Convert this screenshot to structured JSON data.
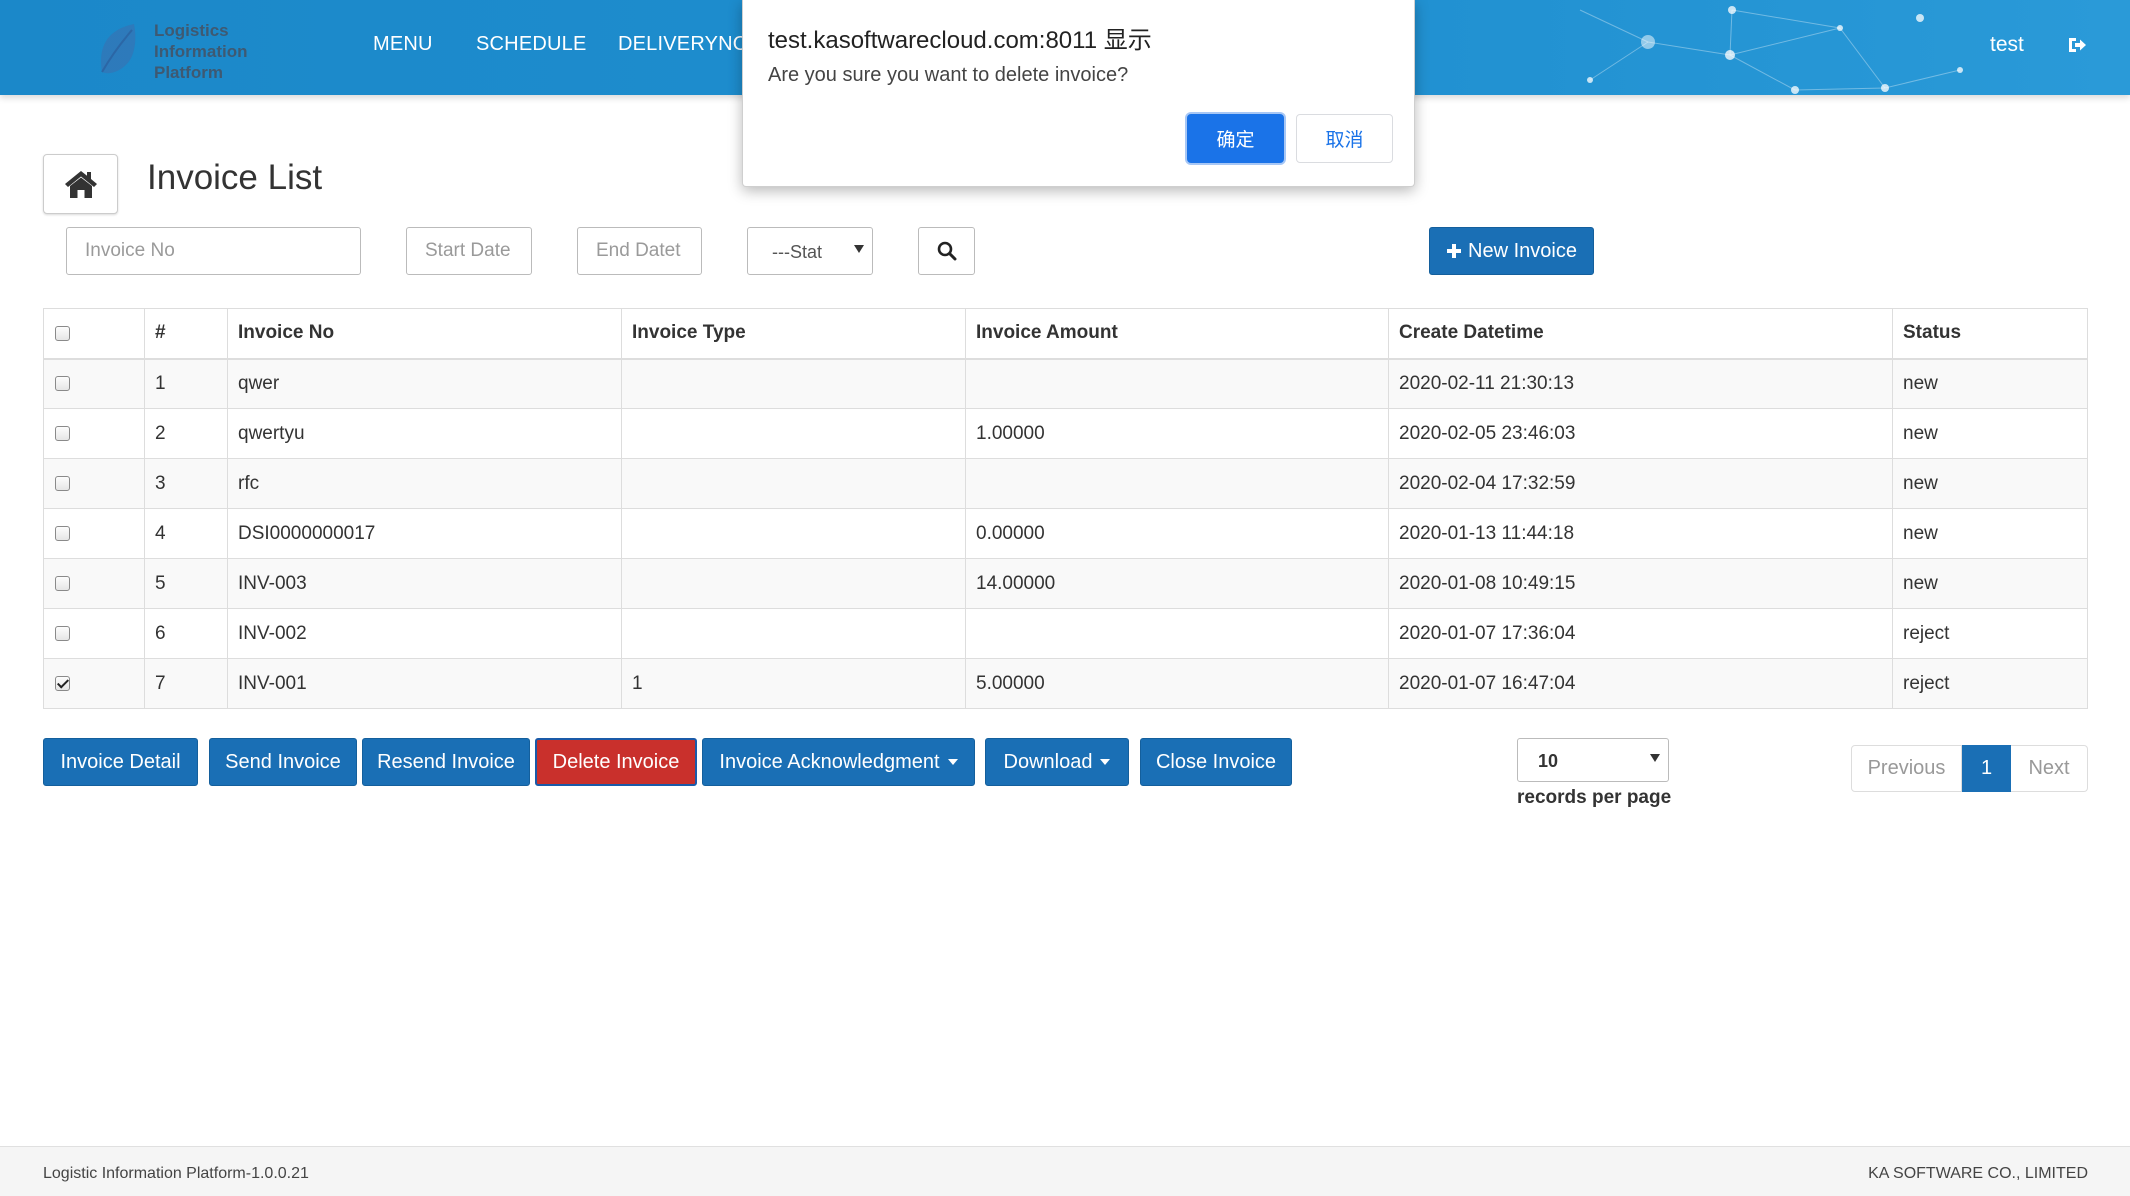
{
  "navbar": {
    "logo_lines": [
      "Logistics",
      "Information",
      "Platform"
    ],
    "items": [
      {
        "label": "MENU"
      },
      {
        "label": "SCHEDULE"
      },
      {
        "label": "DELIVERYNOT"
      }
    ],
    "user": "test",
    "logout_icon": "sign-out-icon"
  },
  "page": {
    "title": "Invoice List",
    "home_icon": "home-icon"
  },
  "filters": {
    "invoice_no_placeholder": "Invoice No",
    "start_date_placeholder": "Start Date",
    "end_date_placeholder": "End Datet",
    "status_selected": "---Stat",
    "search_icon": "search-icon",
    "new_invoice_label": "New Invoice"
  },
  "table": {
    "headers": [
      "#",
      "Invoice No",
      "Invoice Type",
      "Invoice Amount",
      "Create Datetime",
      "Status"
    ],
    "rows": [
      {
        "num": "1",
        "invoice_no": "qwer",
        "type": "",
        "amount": "",
        "created": "2020-02-11 21:30:13",
        "status": "new",
        "checked": false
      },
      {
        "num": "2",
        "invoice_no": "qwertyu",
        "type": "",
        "amount": "1.00000",
        "created": "2020-02-05 23:46:03",
        "status": "new",
        "checked": false
      },
      {
        "num": "3",
        "invoice_no": "rfc",
        "type": "",
        "amount": "",
        "created": "2020-02-04 17:32:59",
        "status": "new",
        "checked": false
      },
      {
        "num": "4",
        "invoice_no": "DSI0000000017",
        "type": "",
        "amount": "0.00000",
        "created": "2020-01-13 11:44:18",
        "status": "new",
        "checked": false
      },
      {
        "num": "5",
        "invoice_no": "INV-003",
        "type": "",
        "amount": "14.00000",
        "created": "2020-01-08 10:49:15",
        "status": "new",
        "checked": false
      },
      {
        "num": "6",
        "invoice_no": "INV-002",
        "type": "",
        "amount": "",
        "created": "2020-01-07 17:36:04",
        "status": "reject",
        "checked": false
      },
      {
        "num": "7",
        "invoice_no": "INV-001",
        "type": "1",
        "amount": "5.00000",
        "created": "2020-01-07 16:47:04",
        "status": "reject",
        "checked": true
      }
    ]
  },
  "actions": {
    "invoice_detail": "Invoice Detail",
    "send_invoice": "Send Invoice",
    "resend_invoice": "Resend Invoice",
    "delete_invoice": "Delete Invoice",
    "invoice_ack": "Invoice Acknowledgment",
    "download": "Download",
    "close_invoice": "Close Invoice"
  },
  "pagination": {
    "per_page_value": "10",
    "per_page_label": "records per page",
    "previous": "Previous",
    "current": "1",
    "next": "Next"
  },
  "footer": {
    "left": "Logistic Information Platform-1.0.0.21",
    "right": "KA SOFTWARE CO., LIMITED"
  },
  "dialog": {
    "origin": "test.kasoftwarecloud.com:8011 显示",
    "message": "Are you sure you want to delete invoice?",
    "ok": "确定",
    "cancel": "取消"
  },
  "colors": {
    "navbar": "#1f8fd0",
    "primary": "#1a6fb5",
    "danger": "#c9302c",
    "dialog_ok": "#1a73e8"
  }
}
